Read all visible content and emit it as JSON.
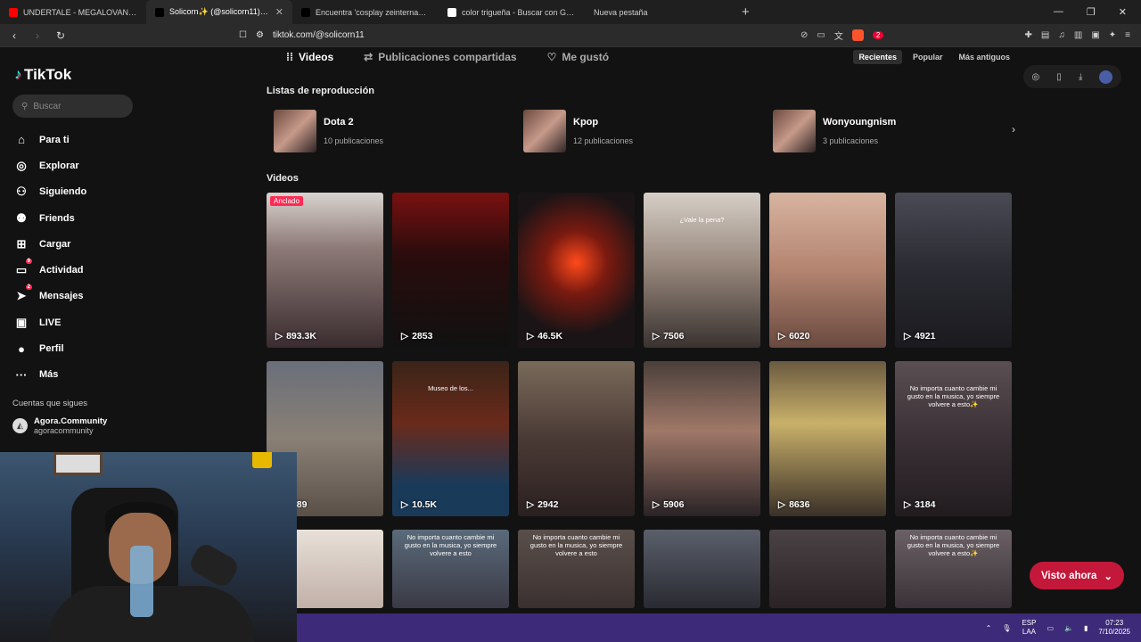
{
  "browser": {
    "tabs": [
      {
        "title": "UNDERTALE - MEGALOVANIA (Pegb",
        "color": "#ff0000",
        "active": false
      },
      {
        "title": "Solicorn✨ (@solicorn11) | TikTok",
        "color": "#000000",
        "active": true
      },
      {
        "title": "Encuentra 'cosplay zeinternacional' e",
        "color": "#000000",
        "active": false
      },
      {
        "title": "color trigueña - Buscar con Google",
        "color": "#ffffff",
        "active": false
      },
      {
        "title": "Nueva pestaña",
        "color": "",
        "active": false
      }
    ],
    "new_tab": "+",
    "url": "tiktok.com/@solicorn11",
    "extension_badge": "2"
  },
  "sidebar": {
    "logo": "TikTok",
    "search_placeholder": "Buscar",
    "items": [
      {
        "label": "Para ti",
        "icon": "home-icon",
        "glyph": "⌂"
      },
      {
        "label": "Explorar",
        "icon": "compass-icon",
        "glyph": "◎"
      },
      {
        "label": "Siguiendo",
        "icon": "following-icon",
        "glyph": "⚇"
      },
      {
        "label": "Friends",
        "icon": "friends-icon",
        "glyph": "⚉"
      },
      {
        "label": "Cargar",
        "icon": "upload-icon",
        "glyph": "⊞"
      },
      {
        "label": "Actividad",
        "icon": "activity-icon",
        "glyph": "▭",
        "badge": "9"
      },
      {
        "label": "Mensajes",
        "icon": "messages-icon",
        "glyph": "➤",
        "badge": "2"
      },
      {
        "label": "LIVE",
        "icon": "live-icon",
        "glyph": "▣"
      },
      {
        "label": "Perfil",
        "icon": "profile-icon",
        "glyph": "●"
      },
      {
        "label": "Más",
        "icon": "more-icon",
        "glyph": "···"
      }
    ],
    "following_title": "Cuentas que sigues",
    "following": [
      {
        "name": "Agora.Community",
        "username": "agoracommunity"
      }
    ]
  },
  "profile": {
    "tabs": [
      {
        "label": "Videos",
        "active": true
      },
      {
        "label": "Publicaciones compartidas",
        "active": false
      },
      {
        "label": "Me gustó",
        "active": false
      }
    ],
    "sort": [
      "Recientes",
      "Popular",
      "Más antiguos"
    ],
    "playlists_title": "Listas de reproducción",
    "playlists": [
      {
        "name": "Dota 2",
        "count": "10 publicaciones"
      },
      {
        "name": "Kpop",
        "count": "12 publicaciones"
      },
      {
        "name": "Wonyoungnism",
        "count": "3 publicaciones"
      }
    ],
    "videos_title": "Videos",
    "videos": [
      {
        "views": "893.3K",
        "pinned": "Anclado",
        "bg": "linear-gradient(180deg,#d9d4d0 0%,#8e7b78 35%,#3a2c2f 100%)"
      },
      {
        "views": "2853",
        "bg": "linear-gradient(180deg,#7a1010 0%,#2a0c0c 40%,#111 100%)"
      },
      {
        "views": "46.5K",
        "bg": "radial-gradient(circle at 50% 45%,#ff4a1a 0%,#7a1a10 30%,#1a1416 70%)"
      },
      {
        "views": "7506",
        "caption": "¿Vale la pena?",
        "bg": "linear-gradient(180deg,#d6cfc7 0%,#9a8a7f 45%,#3a3330 100%)"
      },
      {
        "views": "6020",
        "bg": "linear-gradient(180deg,#d8b4a0 0%,#b38470 50%,#6a4a40 100%)"
      },
      {
        "views": "4921",
        "bg": "linear-gradient(180deg,#4a4a55 0%,#2a2a32 50%,#1a1a1f 100%)"
      },
      {
        "views": "3989",
        "bg": "linear-gradient(180deg,#6a6f7a 0%,#8a8075 50%,#5a5048 100%)"
      },
      {
        "views": "10.5K",
        "caption": "Museo de los...",
        "bg": "linear-gradient(180deg,#3a2418 0%,#6a2a1a 40%,#1a3a5a 80%)"
      },
      {
        "views": "2942",
        "bg": "linear-gradient(180deg,#7a6a5a 0%,#4a3a35 50%,#2a2020 100%)"
      },
      {
        "views": "5906",
        "bg": "linear-gradient(180deg,#4a3f3a 0%,#a07868 45%,#2a2326 100%)"
      },
      {
        "views": "8636",
        "bg": "linear-gradient(180deg,#6a5a40 0%,#c9b06a 40%,#3a3028 100%)"
      },
      {
        "views": "3184",
        "caption": "No importa cuanto cambie mi gusto en la musica, yo siempre volvere a esto✨",
        "bg": "linear-gradient(180deg,#5a4f52 0%,#3a3035 50%,#221c1f 100%)"
      }
    ],
    "videos_row3": [
      {
        "caption": "",
        "bg": "linear-gradient(180deg,#e8e0d8 0%,#c0b0a8 100%)"
      },
      {
        "caption": "No importa cuanto cambie mi gusto en la musica, yo siempre volvere a esto",
        "bg": "linear-gradient(180deg,#5a6a7a 0%,#3a3a45 100%)"
      },
      {
        "caption": "No importa cuanto cambie mi gusto en la musica, yo siempre volvere a esto",
        "bg": "linear-gradient(180deg,#5a4f4a 0%,#3a302f 100%)"
      },
      {
        "caption": "",
        "bg": "linear-gradient(180deg,#5a5f6a 0%,#2a2a32 100%)"
      },
      {
        "caption": "",
        "bg": "linear-gradient(180deg,#4a4245 0%,#2a2224 100%)"
      },
      {
        "caption": "No importa cuanto cambie mi gusto en la musica, yo siempre volvere a esto✨",
        "bg": "linear-gradient(180deg,#6a6065 0%,#3a3236 100%)"
      }
    ],
    "watch_now": "Visto ahora"
  },
  "taskbar": {
    "lang_top": "ESP",
    "lang_bottom": "LAA",
    "time": "07:23",
    "date": "7/10/2025"
  },
  "colors": {
    "accent": "#fe2c55",
    "watch_now": "#c3183a",
    "taskbar": "#3d2a78"
  }
}
